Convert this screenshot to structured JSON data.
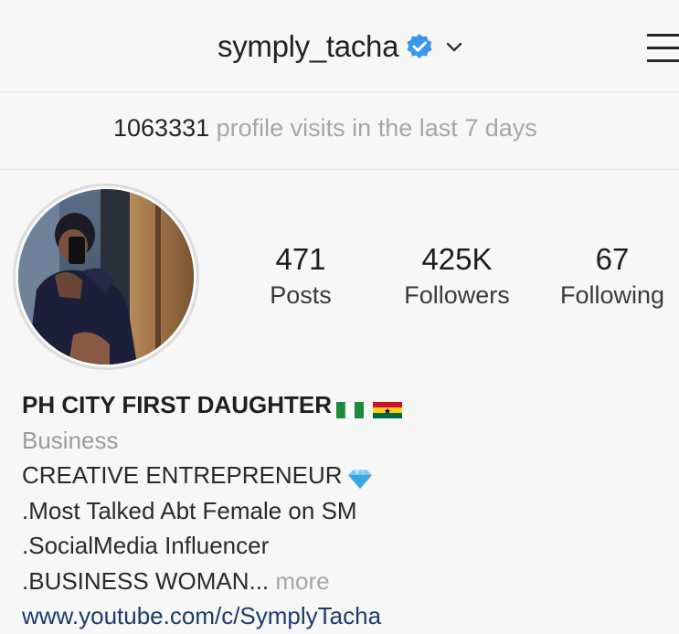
{
  "header": {
    "username": "symply_tacha",
    "verified": true,
    "accent_color": "#3897f0"
  },
  "insights": {
    "visits_count": "1063331",
    "visits_label": "profile visits in the last 7 days"
  },
  "profile": {
    "stats": [
      {
        "value": "471",
        "label": "Posts"
      },
      {
        "value": "425K",
        "label": "Followers"
      },
      {
        "value": "67",
        "label": "Following"
      }
    ]
  },
  "bio": {
    "name": "PH CITY FIRST DAUGHTER",
    "name_emojis": [
      "nigeria-flag-icon",
      "ghana-flag-icon"
    ],
    "category": "Business",
    "line1": "CREATIVE ENTREPRENEUR",
    "line1_emoji": "gem-icon",
    "line2": ".Most Talked Abt Female on SM",
    "line3": ".SocialMedia Influencer",
    "line4": ".BUSINESS WOMAN...",
    "more_label": "more",
    "link": "www.youtube.com/c/SymplyTacha"
  }
}
